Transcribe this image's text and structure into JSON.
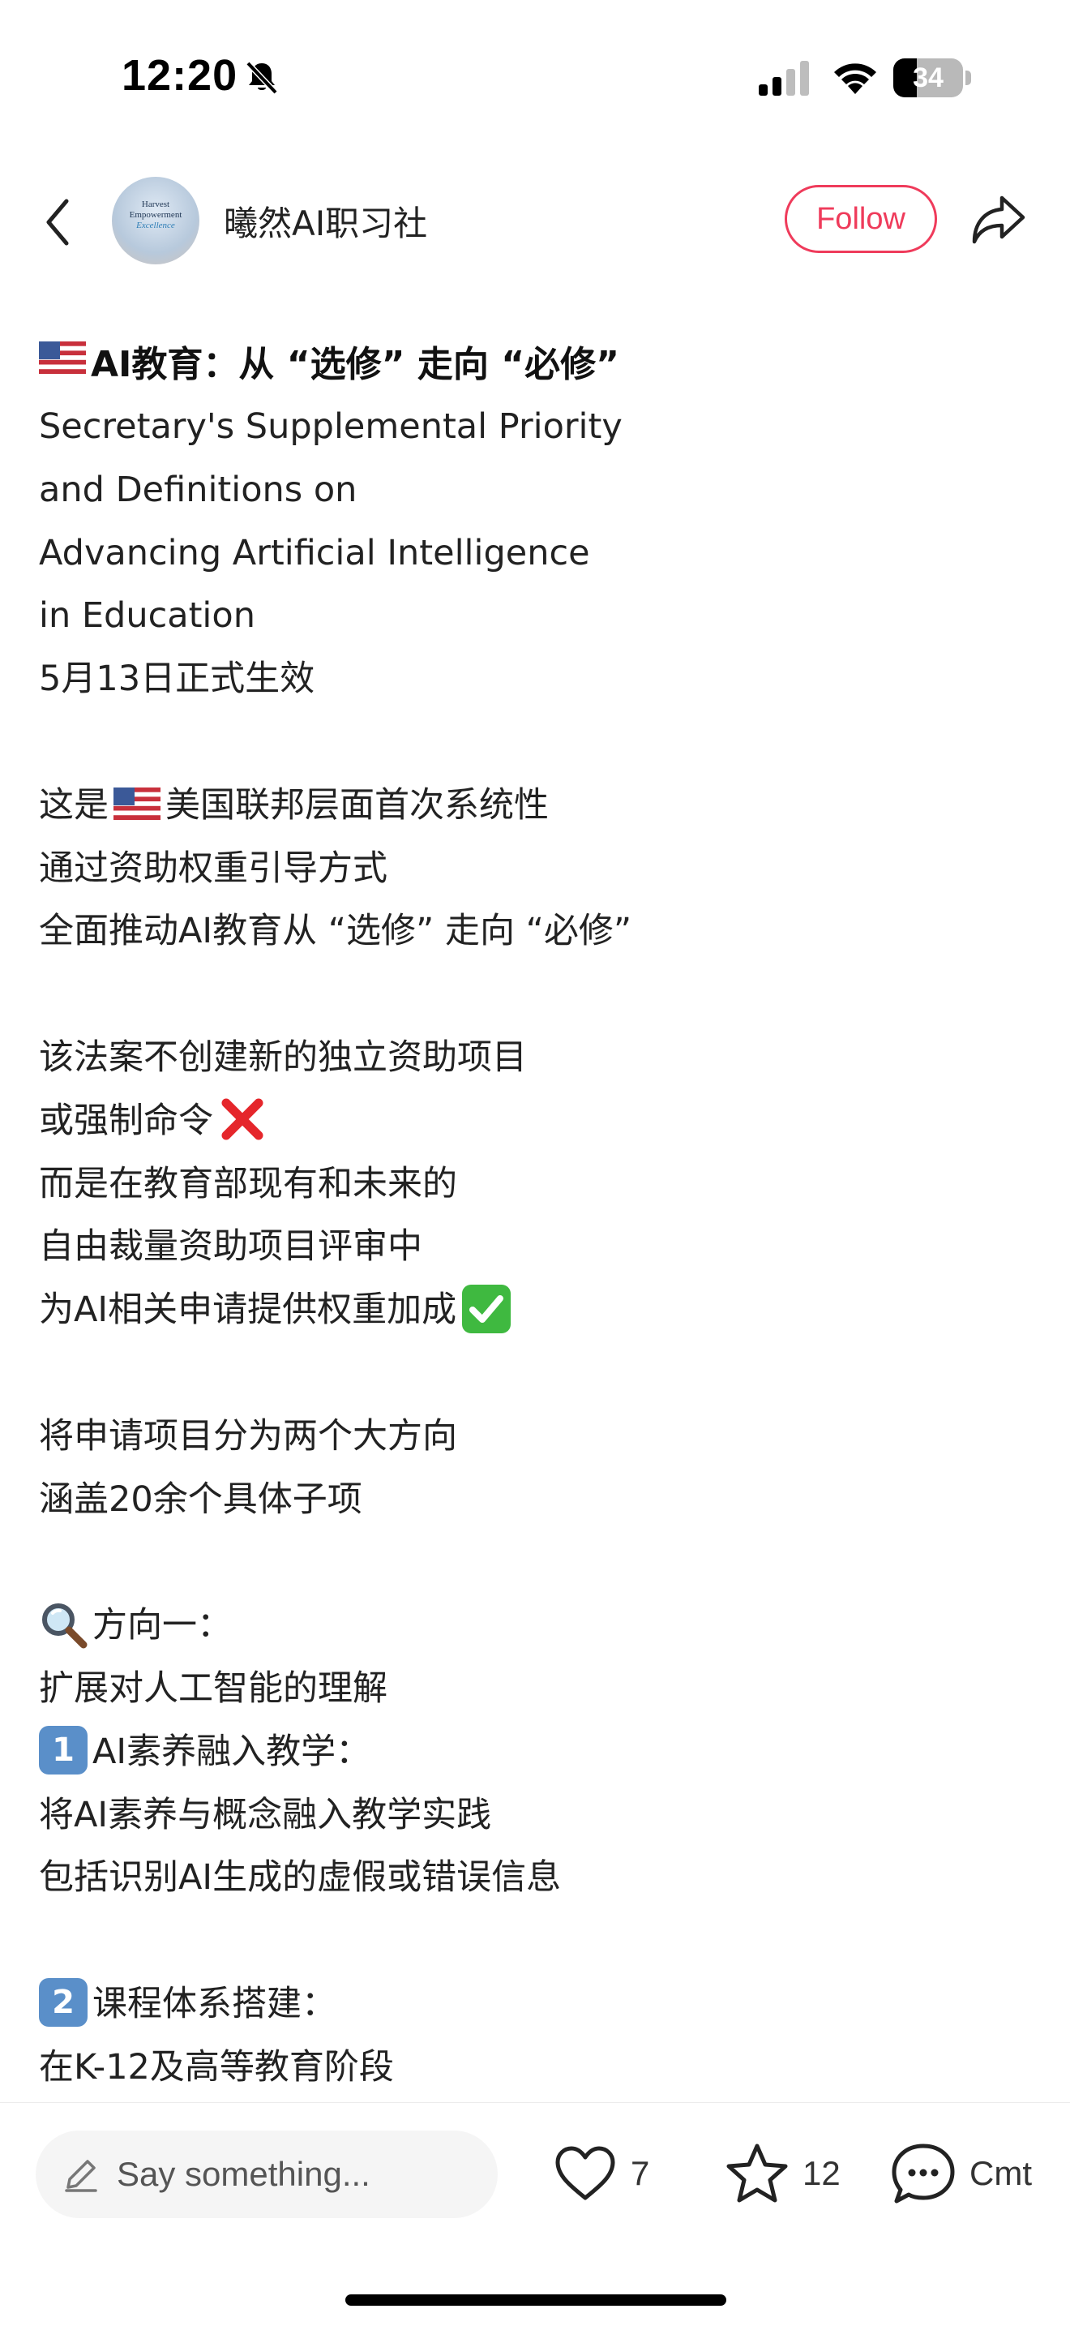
{
  "status_bar": {
    "time": "12:20",
    "battery_level": "34",
    "battery_fraction": 0.34,
    "icons": [
      "bell-slash-icon",
      "cellular-signal-icon",
      "wifi-icon",
      "battery-icon"
    ]
  },
  "header": {
    "avatar_lines": [
      "Harvest",
      "Empowerment",
      "Excellence"
    ],
    "account_name": "曦然AI职习社",
    "follow_label": "Follow",
    "icons": [
      "back-chevron-icon",
      "share-icon"
    ]
  },
  "post": {
    "title": "AI教育：从 “选修” 走向 “必修”",
    "lines": [
      "Secretary's Supplemental Priority",
      "and Definitions on",
      "Advancing Artificial Intelligence",
      "in Education",
      "5月13日正式生效",
      "",
      "这是",
      "美国联邦层面首次系统性",
      "通过资助权重引导方式",
      "全面推动AI教育从 “选修” 走向 “必修”",
      "",
      "该法案不创建新的独立资助项目",
      "或强制命令",
      "而是在教育部现有和未来的",
      "自由裁量资助项目评审中",
      "为AI相关申请提供权重加成",
      "",
      "将申请项目分为两个大方向",
      "涵盖20余个具体子项",
      "",
      "方向一：",
      "扩展对人工智能的理解",
      "AI素养融入教学：",
      "将AI素养与概念融入教学实践",
      "包括识别AI生成的虚假或错误信息",
      "",
      "课程体系搭建：",
      "在K-12及高等教育阶段"
    ],
    "emojis": {
      "flag": "us-flag-emoji",
      "cross": "cross-mark-emoji",
      "check": "check-mark-emoji",
      "search": "magnifier-emoji",
      "keycap_1": "1",
      "keycap_2": "2"
    }
  },
  "bottom_bar": {
    "comment_placeholder": "Say something...",
    "like_count": "7",
    "favorite_count": "12",
    "comment_label": "Cmt"
  },
  "colors": {
    "accent": "#ef3b5b",
    "keycap": "#5a8fc9",
    "cross": "#e5262b",
    "check": "#3fb940",
    "text": "#222222"
  }
}
